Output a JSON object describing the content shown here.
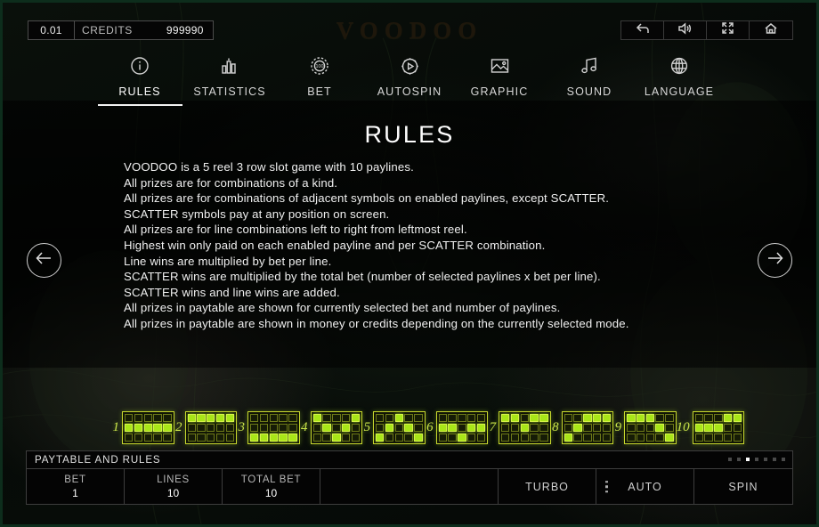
{
  "game": {
    "title": "VOODOO"
  },
  "topbar": {
    "bet_amount": "0.01",
    "credits_label": "CREDITS",
    "credits_value": "999990",
    "icons": [
      {
        "name": "back-icon",
        "label": "back"
      },
      {
        "name": "sound-icon",
        "label": "sound"
      },
      {
        "name": "fullscreen-icon",
        "label": "fullscreen"
      },
      {
        "name": "home-icon",
        "label": "home"
      }
    ]
  },
  "tabs": [
    {
      "label": "RULES",
      "icon": "info-icon",
      "active": true
    },
    {
      "label": "STATISTICS",
      "icon": "bar-chart-icon",
      "active": false
    },
    {
      "label": "BET",
      "icon": "chip-icon",
      "active": false
    },
    {
      "label": "AUTOSPIN",
      "icon": "play-gear-icon",
      "active": false
    },
    {
      "label": "GRAPHIC",
      "icon": "image-icon",
      "active": false
    },
    {
      "label": "SOUND",
      "icon": "music-note-icon",
      "active": false
    },
    {
      "label": "LANGUAGE",
      "icon": "globe-icon",
      "active": false
    }
  ],
  "content": {
    "title": "RULES",
    "rules": [
      "VOODOO is a 5 reel 3 row slot game with 10 paylines.",
      "All prizes are for combinations of a kind.",
      "All prizes are for combinations of adjacent symbols on enabled paylines, except SCATTER.",
      "SCATTER symbols pay at any position on screen.",
      "All prizes are for line combinations left to right from leftmost reel.",
      "Highest win only paid on each enabled payline and per SCATTER combination.",
      "Line wins are multiplied by bet per line.",
      "SCATTER wins are multiplied by the total bet (number of selected paylines x bet per line).",
      "SCATTER wins and line wins are added.",
      "All prizes in paytable are shown for currently selected bet and number of paylines.",
      "All prizes in paytable are shown in money or credits depending on the currently selected mode."
    ]
  },
  "navigation": {
    "prev": {
      "name": "prev-page-arrow",
      "label": "previous"
    },
    "next": {
      "name": "next-page-arrow",
      "label": "next"
    }
  },
  "paylines": [
    {
      "number": "1",
      "rows": [
        [
          0,
          0,
          0,
          0,
          0
        ],
        [
          1,
          1,
          1,
          1,
          1
        ],
        [
          0,
          0,
          0,
          0,
          0
        ]
      ]
    },
    {
      "number": "2",
      "rows": [
        [
          1,
          1,
          1,
          1,
          1
        ],
        [
          0,
          0,
          0,
          0,
          0
        ],
        [
          0,
          0,
          0,
          0,
          0
        ]
      ]
    },
    {
      "number": "3",
      "rows": [
        [
          0,
          0,
          0,
          0,
          0
        ],
        [
          0,
          0,
          0,
          0,
          0
        ],
        [
          1,
          1,
          1,
          1,
          1
        ]
      ]
    },
    {
      "number": "4",
      "rows": [
        [
          1,
          0,
          0,
          0,
          1
        ],
        [
          0,
          1,
          0,
          1,
          0
        ],
        [
          0,
          0,
          1,
          0,
          0
        ]
      ]
    },
    {
      "number": "5",
      "rows": [
        [
          0,
          0,
          1,
          0,
          0
        ],
        [
          0,
          1,
          0,
          1,
          0
        ],
        [
          1,
          0,
          0,
          0,
          1
        ]
      ]
    },
    {
      "number": "6",
      "rows": [
        [
          0,
          0,
          0,
          0,
          0
        ],
        [
          1,
          1,
          0,
          1,
          1
        ],
        [
          0,
          0,
          1,
          0,
          0
        ]
      ]
    },
    {
      "number": "7",
      "rows": [
        [
          1,
          1,
          0,
          1,
          1
        ],
        [
          0,
          0,
          1,
          0,
          0
        ],
        [
          0,
          0,
          0,
          0,
          0
        ]
      ]
    },
    {
      "number": "8",
      "rows": [
        [
          0,
          0,
          1,
          1,
          1
        ],
        [
          0,
          1,
          0,
          0,
          0
        ],
        [
          1,
          0,
          0,
          0,
          0
        ]
      ]
    },
    {
      "number": "9",
      "rows": [
        [
          1,
          1,
          1,
          0,
          0
        ],
        [
          0,
          0,
          0,
          1,
          0
        ],
        [
          0,
          0,
          0,
          0,
          1
        ]
      ]
    },
    {
      "number": "10",
      "rows": [
        [
          0,
          0,
          0,
          1,
          1
        ],
        [
          1,
          1,
          1,
          0,
          0
        ],
        [
          0,
          0,
          0,
          0,
          0
        ]
      ]
    }
  ],
  "bottom": {
    "header_title": "PAYTABLE AND RULES",
    "pagination": {
      "count": 7,
      "active_index": 2
    },
    "bet": {
      "label": "BET",
      "value": "1"
    },
    "lines": {
      "label": "LINES",
      "value": "10"
    },
    "total_bet": {
      "label": "TOTAL BET",
      "value": "10"
    },
    "turbo_label": "TURBO",
    "auto_label": "AUTO",
    "spin_label": "SPIN"
  },
  "colors": {
    "payline_on": "#a8e618",
    "payline_border": "#c8d82e",
    "frame": "#0d2d1c",
    "text": "#f0f0f0"
  }
}
